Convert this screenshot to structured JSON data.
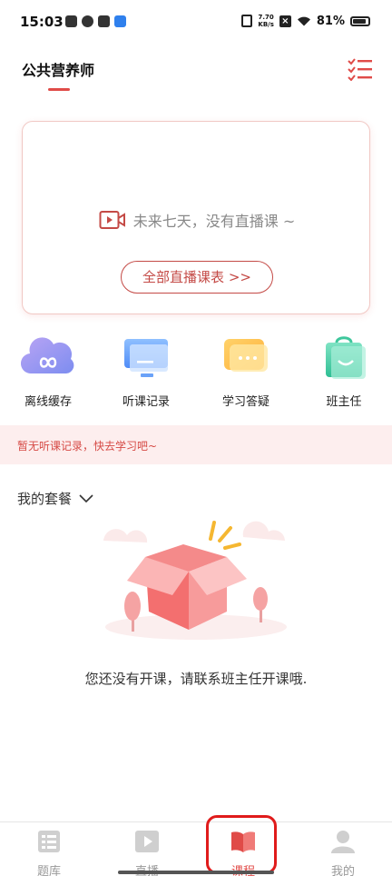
{
  "status_bar": {
    "time": "15:03",
    "net_speed_value": "7.70",
    "net_speed_unit": "KB/s",
    "battery": "81%"
  },
  "header": {
    "title": "公共营养师",
    "accent_color": "#e04b48"
  },
  "live": {
    "empty_text": "未来七天，没有直播课 ~",
    "schedule_button": "全部直播课表 >>"
  },
  "quick_links": [
    {
      "label": "离线缓存",
      "icon": "cloud-infinity-icon"
    },
    {
      "label": "听课记录",
      "icon": "monitor-icon"
    },
    {
      "label": "学习答疑",
      "icon": "chat-bubble-icon"
    },
    {
      "label": "班主任",
      "icon": "smile-bag-icon"
    }
  ],
  "notice": {
    "text": "暂无听课记录，快去学习吧~"
  },
  "packages": {
    "title": "我的套餐",
    "empty_message": "您还没有开课，请联系班主任开课哦."
  },
  "tabbar": {
    "active": "课程",
    "items": [
      {
        "label": "题库",
        "icon": "question-bank-icon"
      },
      {
        "label": "直播",
        "icon": "play-icon"
      },
      {
        "label": "课程",
        "icon": "book-icon"
      },
      {
        "label": "我的",
        "icon": "user-icon"
      }
    ]
  }
}
